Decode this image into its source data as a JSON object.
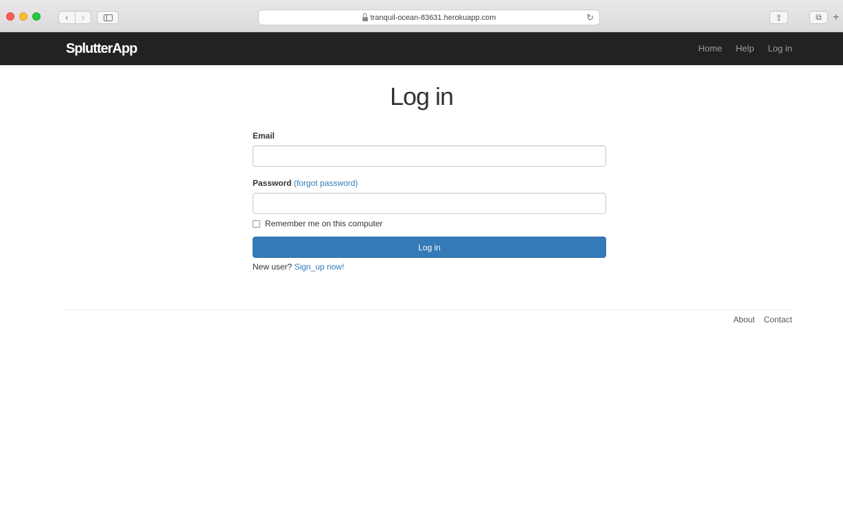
{
  "browser": {
    "url": "tranquil-ocean-83631.herokuapp.com",
    "back_glyph": "‹",
    "forward_glyph": "›",
    "reload_glyph": "↻",
    "share_glyph": "⇪",
    "tabs_glyph": "⧉",
    "new_tab_glyph": "+",
    "icons": [
      "close-icon",
      "minimize-icon",
      "zoom-icon",
      "back-icon",
      "forward-icon",
      "sidebar-icon",
      "lock-icon",
      "reload-icon",
      "share-icon",
      "tabs-icon",
      "new-tab-icon"
    ]
  },
  "navbar": {
    "brand": "SplutterApp",
    "links": [
      "Home",
      "Help",
      "Log in"
    ]
  },
  "main": {
    "title": "Log in",
    "email_label": "Email",
    "email_value": "",
    "password_label": "Password",
    "forgot_link": "(forgot password)",
    "password_value": "",
    "remember_label": "Remember me on this computer",
    "remember_checked": false,
    "submit_label": "Log in",
    "new_user_text": "New user?",
    "signup_link": "Sign_up now!"
  },
  "footer": {
    "links": [
      "About",
      "Contact"
    ]
  },
  "colors": {
    "navbar_bg": "#222222",
    "primary": "#337ab7",
    "link": "#337ab7"
  }
}
